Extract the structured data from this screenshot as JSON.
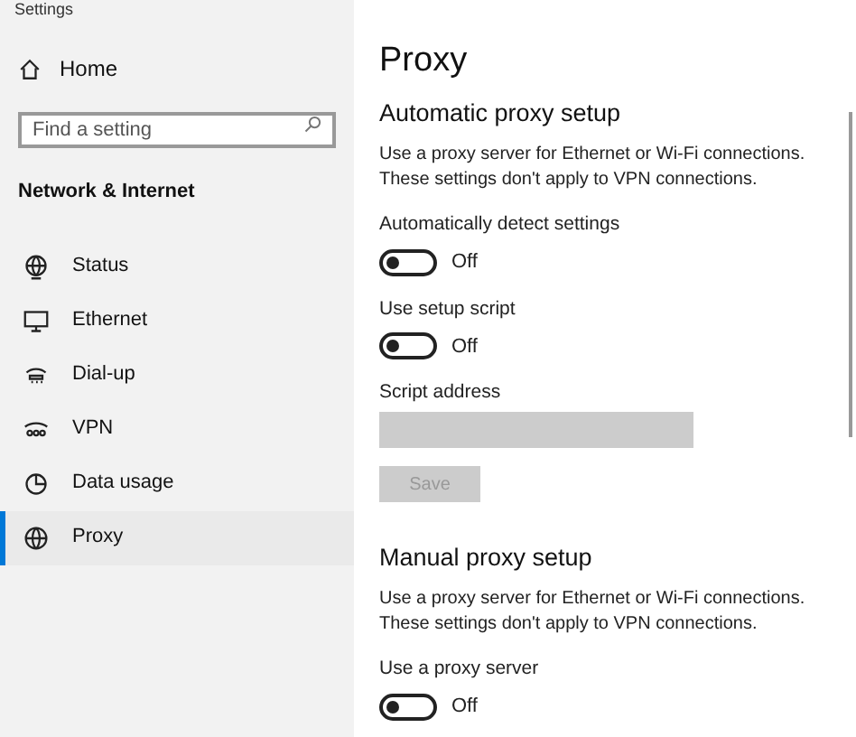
{
  "window": {
    "title": "Settings"
  },
  "sidebar": {
    "home": "Home",
    "search": {
      "placeholder": "Find a setting"
    },
    "category": "Network & Internet",
    "items": [
      {
        "label": "Status",
        "selected": false
      },
      {
        "label": "Ethernet",
        "selected": false
      },
      {
        "label": "Dial-up",
        "selected": false
      },
      {
        "label": "VPN",
        "selected": false
      },
      {
        "label": "Data usage",
        "selected": false
      },
      {
        "label": "Proxy",
        "selected": true
      }
    ]
  },
  "page": {
    "title": "Proxy",
    "sections": [
      {
        "heading": "Automatic proxy setup",
        "description": "Use a proxy server for Ethernet or Wi-Fi connections. These settings don't apply to VPN connections.",
        "controls": [
          {
            "kind": "toggle",
            "label": "Automatically detect settings",
            "on": false,
            "state": "Off"
          },
          {
            "kind": "toggle",
            "label": "Use setup script",
            "on": false,
            "state": "Off"
          },
          {
            "kind": "field",
            "label": "Script address",
            "disabled": true
          },
          {
            "kind": "button",
            "label": "Save",
            "disabled": true
          }
        ]
      },
      {
        "heading": "Manual proxy setup",
        "description": "Use a proxy server for Ethernet or Wi-Fi connections. These settings don't apply to VPN connections.",
        "controls": [
          {
            "kind": "toggle",
            "label": "Use a proxy server",
            "on": false,
            "state": "Off"
          }
        ]
      }
    ]
  }
}
